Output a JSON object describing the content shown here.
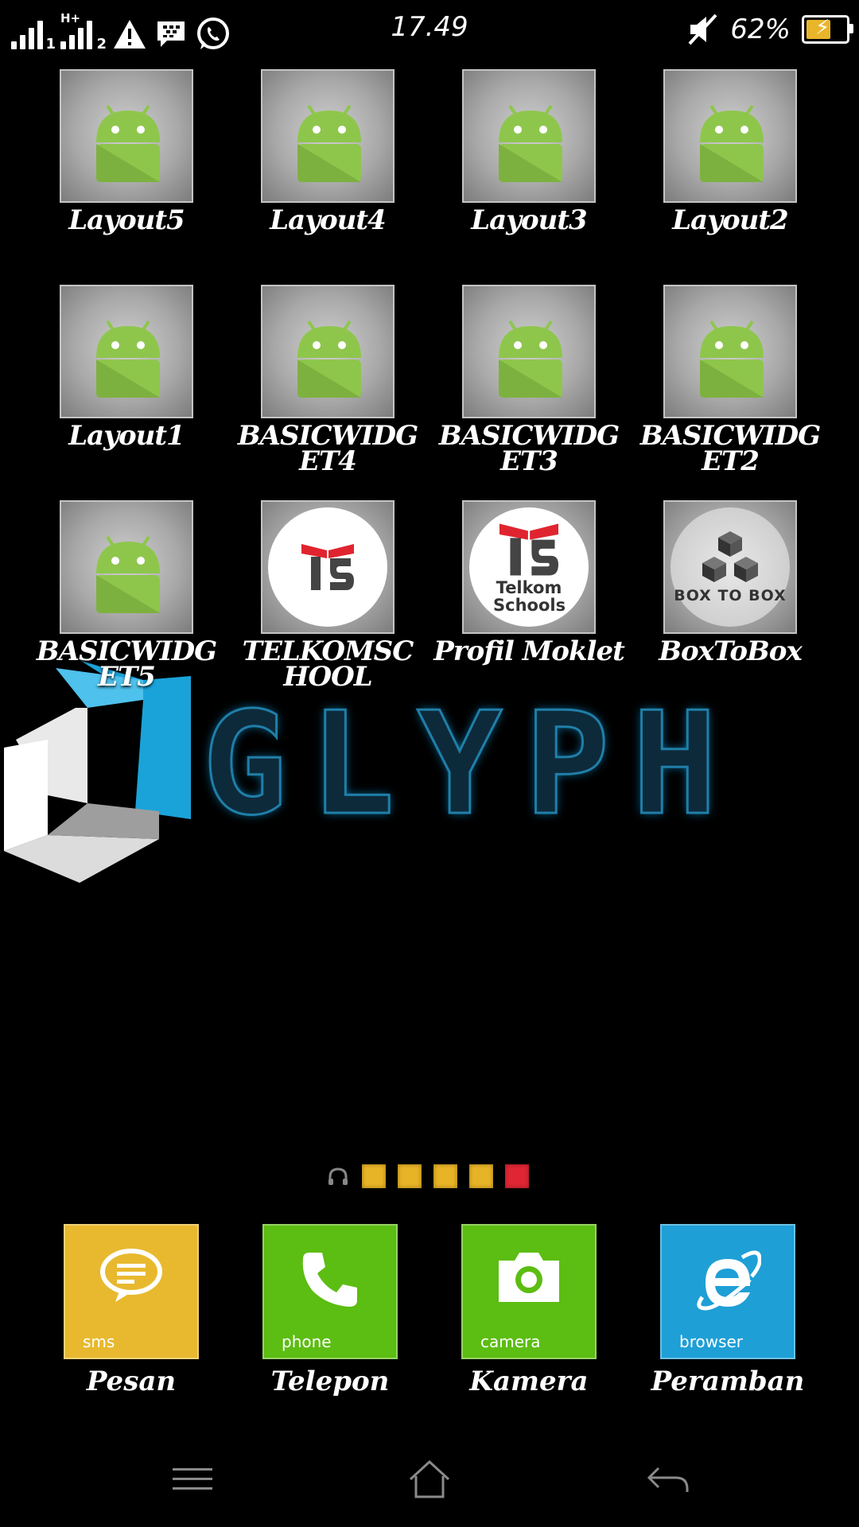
{
  "status_bar": {
    "sim1_slot": "1",
    "sim2_slot": "2",
    "network_type": "H+",
    "icons": [
      "signal-sim1-icon",
      "signal-sim2-icon",
      "warning-icon",
      "blackberry-messenger-icon",
      "whatsapp-icon",
      "mute-icon",
      "battery-charging-icon"
    ],
    "time": "17.49",
    "battery_percent": "62%",
    "battery_level": 0.62
  },
  "apps": [
    {
      "label": "Layout5",
      "icon": "android-icon"
    },
    {
      "label": "Layout4",
      "icon": "android-icon"
    },
    {
      "label": "Layout3",
      "icon": "android-icon"
    },
    {
      "label": "Layout2",
      "icon": "android-icon"
    },
    {
      "label": "Layout1",
      "icon": "android-icon"
    },
    {
      "label": "BASICWIDGET4",
      "icon": "android-icon"
    },
    {
      "label": "BASICWIDGET3",
      "icon": "android-icon"
    },
    {
      "label": "BASICWIDGET2",
      "icon": "android-icon"
    },
    {
      "label": "BASICWIDGET5",
      "icon": "android-icon"
    },
    {
      "label": "TELKOMSCHOOL",
      "icon": "telkom-schools-logo"
    },
    {
      "label": "Profil Moklet",
      "icon": "telkom-schools-logo",
      "logo_text": "Telkom Schools"
    },
    {
      "label": "BoxToBox",
      "icon": "box-to-box-logo",
      "logo_text": "BOX TO BOX"
    }
  ],
  "wallpaper": {
    "text": "GLYPH",
    "accent": "#1aa3d9"
  },
  "pager": {
    "pages": 5,
    "active_index": 4,
    "icon": "headphones-icon"
  },
  "dock": [
    {
      "label": "Pesan",
      "tile_text": "sms",
      "color": "#e8b92f",
      "icon": "chat-bubble-icon"
    },
    {
      "label": "Telepon",
      "tile_text": "phone",
      "color": "#5cbd12",
      "icon": "phone-icon"
    },
    {
      "label": "Kamera",
      "tile_text": "camera",
      "color": "#5cbd12",
      "icon": "camera-icon"
    },
    {
      "label": "Peramban",
      "tile_text": "browser",
      "color": "#1e9fd6",
      "icon": "internet-explorer-icon"
    }
  ],
  "nav": [
    "menu-icon",
    "home-icon",
    "back-icon"
  ]
}
